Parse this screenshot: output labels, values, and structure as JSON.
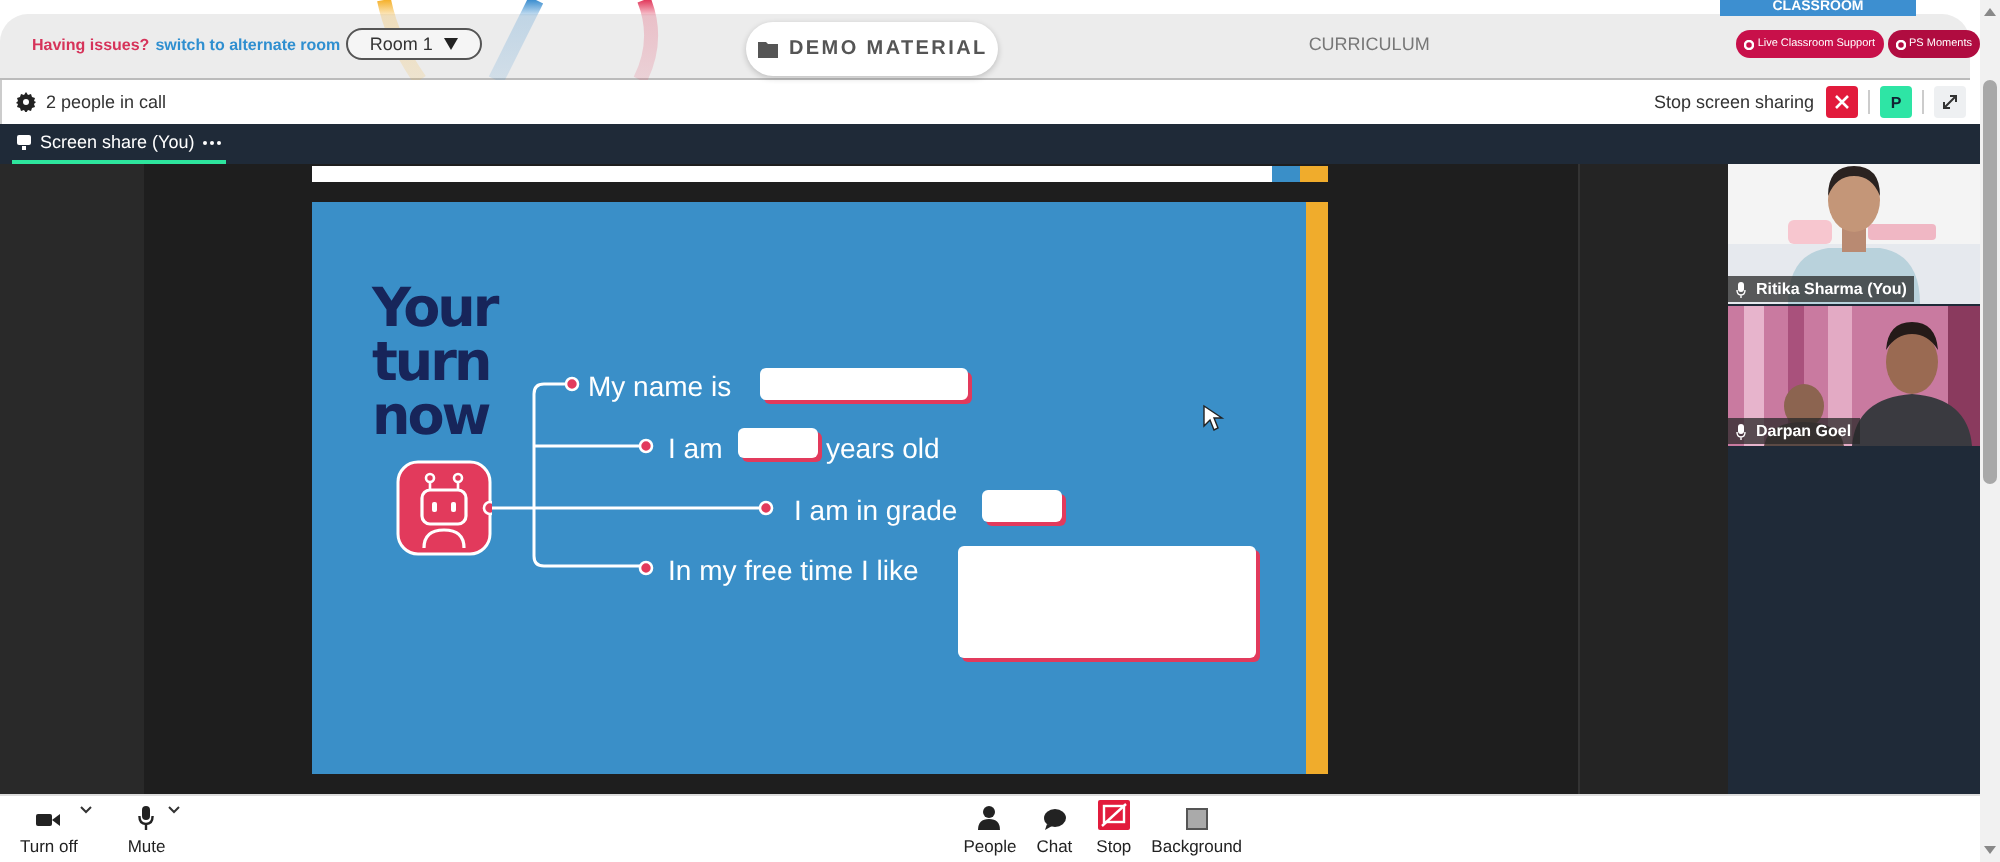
{
  "header": {
    "help_text": "Having issues?",
    "help_link": "switch to alternate room",
    "room_select": "Room 1",
    "demo_material": "DEMO MATERIAL",
    "curriculum": "CURRICULUM",
    "classroom_tab": "CLASSROOM",
    "buttons": [
      "Live Classroom Support",
      "PS Moments"
    ]
  },
  "call_bar": {
    "people_count": "2 people in call",
    "stop_label": "Stop screen sharing",
    "avatar_letter": "P"
  },
  "tabs": [
    {
      "label": "Screen share (You)",
      "selected": true
    }
  ],
  "slide": {
    "title_lines": [
      "Your",
      "turn",
      "now"
    ],
    "prompts": [
      {
        "before": "My name is"
      },
      {
        "before": "I am",
        "after": "years old"
      },
      {
        "before": "I am in grade"
      },
      {
        "before": "In my free time I like"
      }
    ]
  },
  "participants": [
    {
      "name": "Ritika Sharma (You)",
      "kind": "picture"
    },
    {
      "name": "Darpan Goel",
      "kind": "picture"
    }
  ],
  "controls": [
    {
      "label": "Turn off",
      "kind": "camera",
      "menu": true
    },
    {
      "label": "Mute",
      "kind": "mic",
      "menu": true
    },
    {
      "label": "People",
      "kind": "person",
      "menu": false
    },
    {
      "label": "Chat",
      "kind": "chat",
      "menu": false
    },
    {
      "label": "Stop",
      "kind": "stop",
      "menu": false
    },
    {
      "label": "Background",
      "kind": "background",
      "menu": false
    }
  ]
}
